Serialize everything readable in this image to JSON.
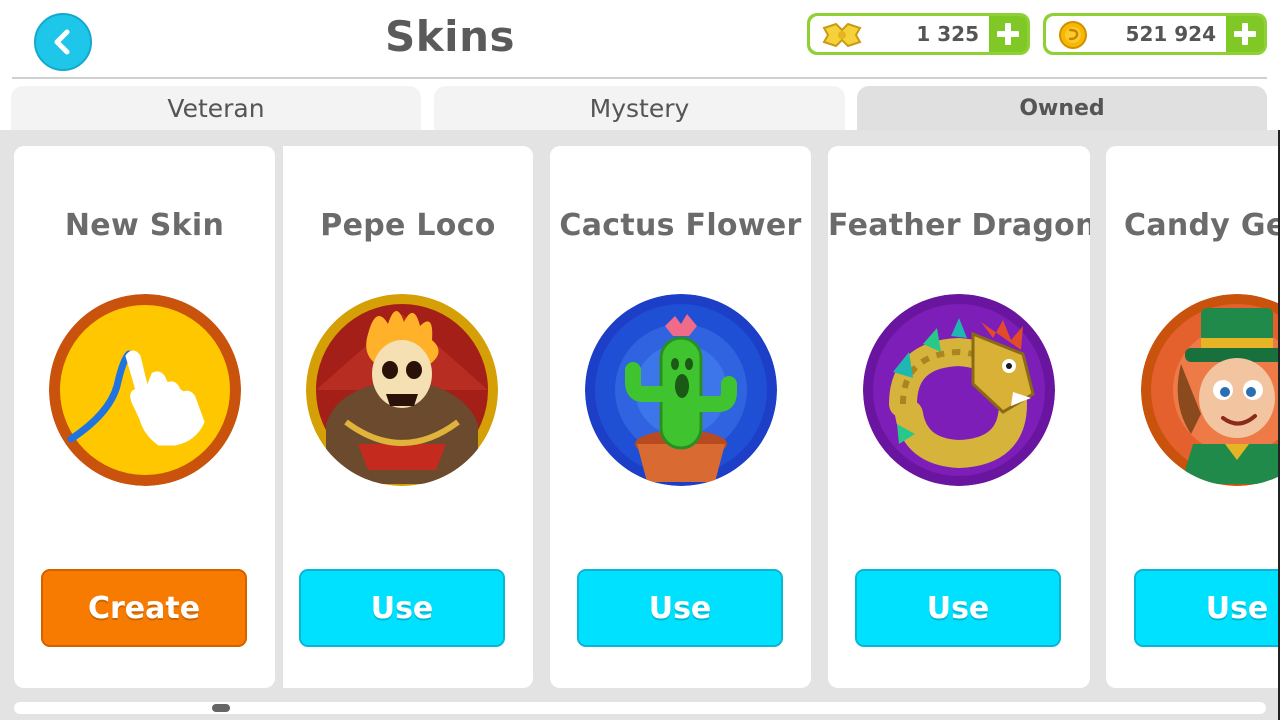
{
  "header": {
    "title": "Skins",
    "back_icon": "chevron-left-icon"
  },
  "currencies": [
    {
      "icon": "ticket-icon",
      "amount": "1 325"
    },
    {
      "icon": "coin-icon",
      "amount": "521 924"
    }
  ],
  "tabs": [
    {
      "label": "Veteran",
      "active": false
    },
    {
      "label": "Mystery",
      "active": false
    },
    {
      "label": "Owned",
      "active": true
    }
  ],
  "cards": [
    {
      "name": "New Skin",
      "button": "Create",
      "avatar": "draw-skin-icon"
    },
    {
      "name": "Pepe Loco",
      "button": "Use",
      "avatar": "flaming-skull-avatar"
    },
    {
      "name": "Cactus Flower",
      "button": "Use",
      "avatar": "cactus-avatar"
    },
    {
      "name": "Feather Dragon",
      "button": "Use",
      "avatar": "feather-dragon-avatar"
    },
    {
      "name": "Candy Ge",
      "button": "Use",
      "avatar": "leprechaun-avatar"
    }
  ],
  "colors": {
    "accent_cyan": "#00e1ff",
    "create_orange": "#f77b00",
    "currency_green": "#8fd135",
    "title_gray": "#5a5a5a"
  }
}
